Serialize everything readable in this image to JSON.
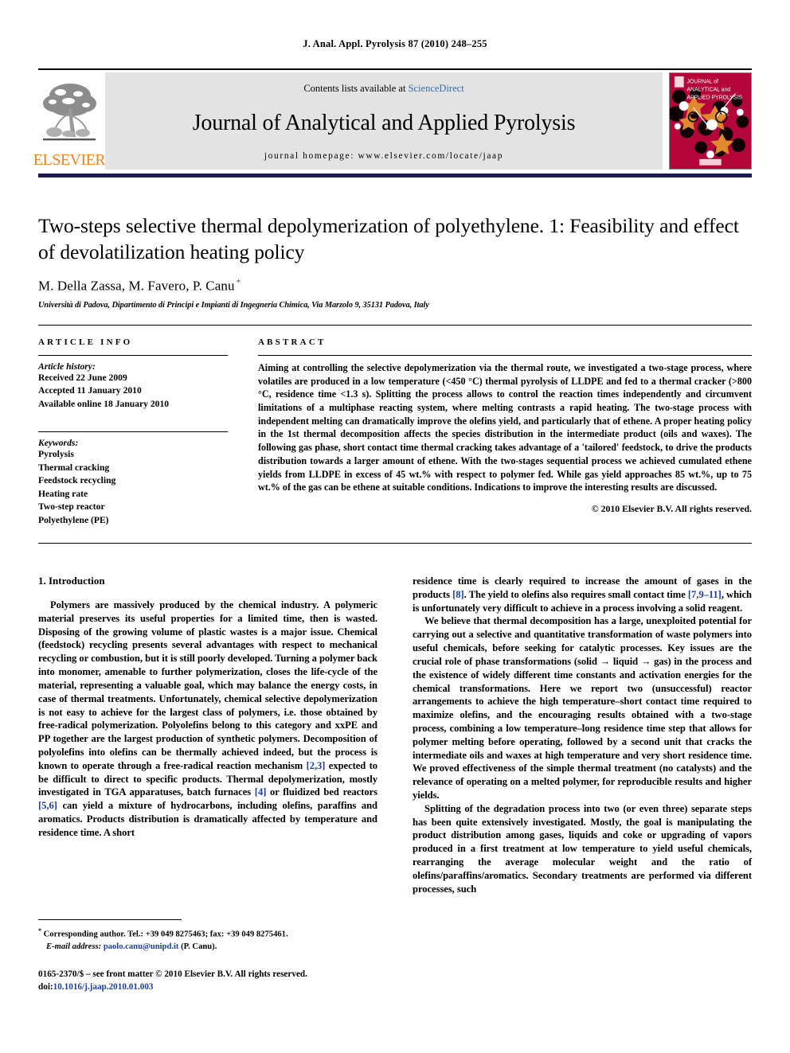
{
  "running_head": "J. Anal. Appl. Pyrolysis 87 (2010) 248–255",
  "masthead": {
    "contents_prefix": "Contents lists available at ",
    "sciencedirect": "ScienceDirect",
    "journal_title": "Journal of Analytical and Applied Pyrolysis",
    "homepage": "journal homepage: www.elsevier.com/locate/jaap",
    "publisher": "ELSEVIER",
    "cover": {
      "line1": "JOURNAL of",
      "line2": "ANALYTICAL and",
      "line3": "APPLIED PYROLYSIS",
      "bg_color": "#b4063a",
      "accent_color": "#e08a2e"
    }
  },
  "article": {
    "title": "Two-steps selective thermal depolymerization of polyethylene. 1: Feasibility and effect of devolatilization heating policy",
    "authors": "M. Della Zassa, M. Favero, P. Canu",
    "corresponding_marker": "*",
    "affiliation": "Università di Padova, Dipartimento di Principi e Impianti di Ingegneria Chimica, Via Marzolo 9, 35131 Padova, Italy"
  },
  "article_info": {
    "label": "ARTICLE INFO",
    "history_label": "Article history:",
    "history": [
      "Received 22 June 2009",
      "Accepted 11 January 2010",
      "Available online 18 January 2010"
    ],
    "keywords_label": "Keywords:",
    "keywords": [
      "Pyrolysis",
      "Thermal cracking",
      "Feedstock recycling",
      "Heating rate",
      "Two-step reactor",
      "Polyethylene (PE)"
    ]
  },
  "abstract": {
    "label": "ABSTRACT",
    "text": "Aiming at controlling the selective depolymerization via the thermal route, we investigated a two-stage process, where volatiles are produced in a low temperature (<450 °C) thermal pyrolysis of LLDPE and fed to a thermal cracker (>800 °C, residence time <1.3 s). Splitting the process allows to control the reaction times independently and circumvent limitations of a multiphase reacting system, where melting contrasts a rapid heating. The two-stage process with independent melting can dramatically improve the olefins yield, and particularly that of ethene. A proper heating policy in the 1st thermal decomposition affects the species distribution in the intermediate product (oils and waxes). The following gas phase, short contact time thermal cracking takes advantage of a 'tailored' feedstock, to drive the products distribution towards a larger amount of ethene. With the two-stages sequential process we achieved cumulated ethene yields from LLDPE in excess of 45 wt.% with respect to polymer fed. While gas yield approaches 85 wt.%, up to 75 wt.% of the gas can be ethene at suitable conditions. Indications to improve the interesting results are discussed.",
    "copyright": "© 2010 Elsevier B.V. All rights reserved."
  },
  "body": {
    "section_title": "1. Introduction",
    "left_paragraphs": [
      "Polymers are massively produced by the chemical industry. A polymeric material preserves its useful properties for a limited time, then is wasted. Disposing of the growing volume of plastic wastes is a major issue. Chemical (feedstock) recycling presents several advantages with respect to mechanical recycling or combustion, but it is still poorly developed. Turning a polymer back into monomer, amenable to further polymerization, closes the life-cycle of the material, representing a valuable goal, which may balance the energy costs, in case of thermal treatments. Unfortunately, chemical selective depolymerization is not easy to achieve for the largest class of polymers, i.e. those obtained by free-radical polymerization. Polyolefins belong to this category and xxPE and PP together are the largest production of synthetic polymers. Decomposition of polyolefins into olefins can be thermally achieved indeed, but the process is known to operate through a free-radical reaction mechanism [2,3] expected to be difficult to direct to specific products. Thermal depolymerization, mostly investigated in TGA apparatuses, batch furnaces [4] or fluidized bed reactors [5,6] can yield a mixture of hydrocarbons, including olefins, paraffins and aromatics. Products distribution is dramatically affected by temperature and residence time. A short"
    ],
    "right_paragraphs": [
      "residence time is clearly required to increase the amount of gases in the products [8]. The yield to olefins also requires small contact time [7,9–11], which is unfortunately very difficult to achieve in a process involving a solid reagent.",
      "We believe that thermal decomposition has a large, unexploited potential for carrying out a selective and quantitative transformation of waste polymers into useful chemicals, before seeking for catalytic processes. Key issues are the crucial role of phase transformations (solid → liquid → gas) in the process and the existence of widely different time constants and activation energies for the chemical transformations. Here we report two (unsuccessful) reactor arrangements to achieve the high temperature–short contact time required to maximize olefins, and the encouraging results obtained with a two-stage process, combining a low temperature–long residence time step that allows for polymer melting before operating, followed by a second unit that cracks the intermediate oils and waxes at high temperature and very short residence time. We proved effectiveness of the simple thermal treatment (no catalysts) and the relevance of operating on a melted polymer, for reproducible results and higher yields.",
      "Splitting of the degradation process into two (or even three) separate steps has been quite extensively investigated. Mostly, the goal is manipulating the product distribution among gases, liquids and coke or upgrading of vapors produced in a first treatment at low temperature to yield useful chemicals, rearranging the average molecular weight and the ratio of olefins/paraffins/aromatics. Secondary treatments are performed via different processes, such"
    ]
  },
  "footnotes": {
    "corresponding": "Corresponding author. Tel.: +39 049 8275463; fax: +39 049 8275461.",
    "email_label": "E-mail address:",
    "email": "paolo.canu@unipd.it",
    "email_suffix": "(P. Canu)."
  },
  "imprint": {
    "issn_line": "0165-2370/$ – see front matter © 2010 Elsevier B.V. All rights reserved.",
    "doi_prefix": "doi:",
    "doi": "10.1016/j.jaap.2010.01.003"
  },
  "colors": {
    "link": "#1b3fa0",
    "sciencedirect": "#2f6fb5",
    "elsevier_orange": "#f58220",
    "rule_navy": "#1b1b4f"
  }
}
